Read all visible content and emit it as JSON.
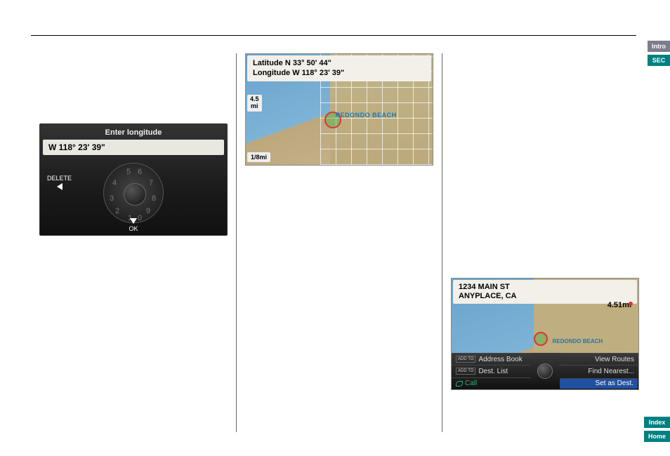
{
  "tabs": {
    "intro": "Intro",
    "sec": "SEC",
    "index": "Index",
    "home": "Home"
  },
  "screen1": {
    "title": "Enter longitude",
    "readout": "W 118° 23' 39\"",
    "delete": "DELETE",
    "ok": "OK",
    "digits": {
      "d0": "0",
      "d1": "1",
      "d2": "2",
      "d3": "3",
      "d4": "4",
      "d5": "5",
      "d6": "6",
      "d7": "7",
      "d8": "8",
      "d9": "9"
    }
  },
  "screen2": {
    "lat_label": "Latitude N 33° 50' 44\"",
    "lon_label": "Longitude W 118° 23' 39\"",
    "distance_value": "4.5",
    "distance_unit": "mi",
    "scale": "1/8mi",
    "place": "REDONDO BEACH"
  },
  "screen3": {
    "addr_line1": "1234 MAIN ST",
    "addr_line2": "ANYPLACE, CA",
    "distance": "4.51mi",
    "place": "REDONDO BEACH",
    "addto": "ADD TO",
    "menu": {
      "address_book": "Address Book",
      "dest_list": "Dest. List",
      "call": "Call",
      "view_routes": "View Routes",
      "find_nearest": "Find Nearest...",
      "set_as_dest": "Set as Dest."
    }
  }
}
